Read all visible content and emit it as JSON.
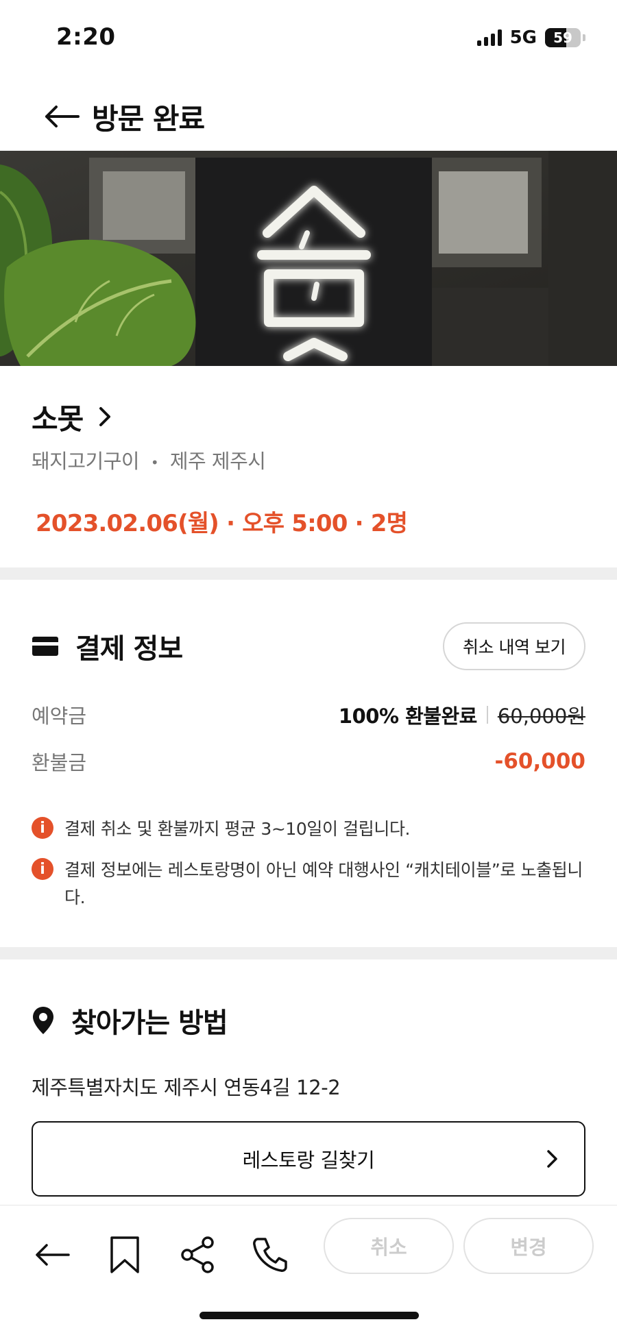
{
  "status_bar": {
    "time": "2:20",
    "network": "5G",
    "battery": 59
  },
  "header": {
    "title": "방문 완료"
  },
  "restaurant": {
    "name": "소못",
    "category": "돼지고기구이",
    "location": "제주 제주시",
    "bullet": "•",
    "datetime": "2023.02.06(월) · 오후 5:00 · 2명"
  },
  "payment": {
    "title": "결제 정보",
    "cancel_history_label": "취소 내역 보기",
    "deposit_label": "예약금",
    "refund_status": "100% 환불완료",
    "original_price": "60,000원",
    "refund_label": "환불금",
    "refund_amount": "-60,000",
    "notices": [
      "결제 취소 및 환불까지 평균 3~10일이 걸립니다.",
      "결제 정보에는 레스토랑명이 아닌 예약 대행사인 “캐치테이블”로 노출됩니다."
    ]
  },
  "directions": {
    "title": "찾아가는 방법",
    "address": "제주특별자치도 제주시 연동4길 12-2",
    "find_way_label": "레스토랑 길찾기"
  },
  "bottom_bar": {
    "cancel_label": "취소",
    "change_label": "변경"
  },
  "colors": {
    "accent": "#e4512a",
    "divider": "#eeeeee",
    "disabled": "#cccccc"
  }
}
